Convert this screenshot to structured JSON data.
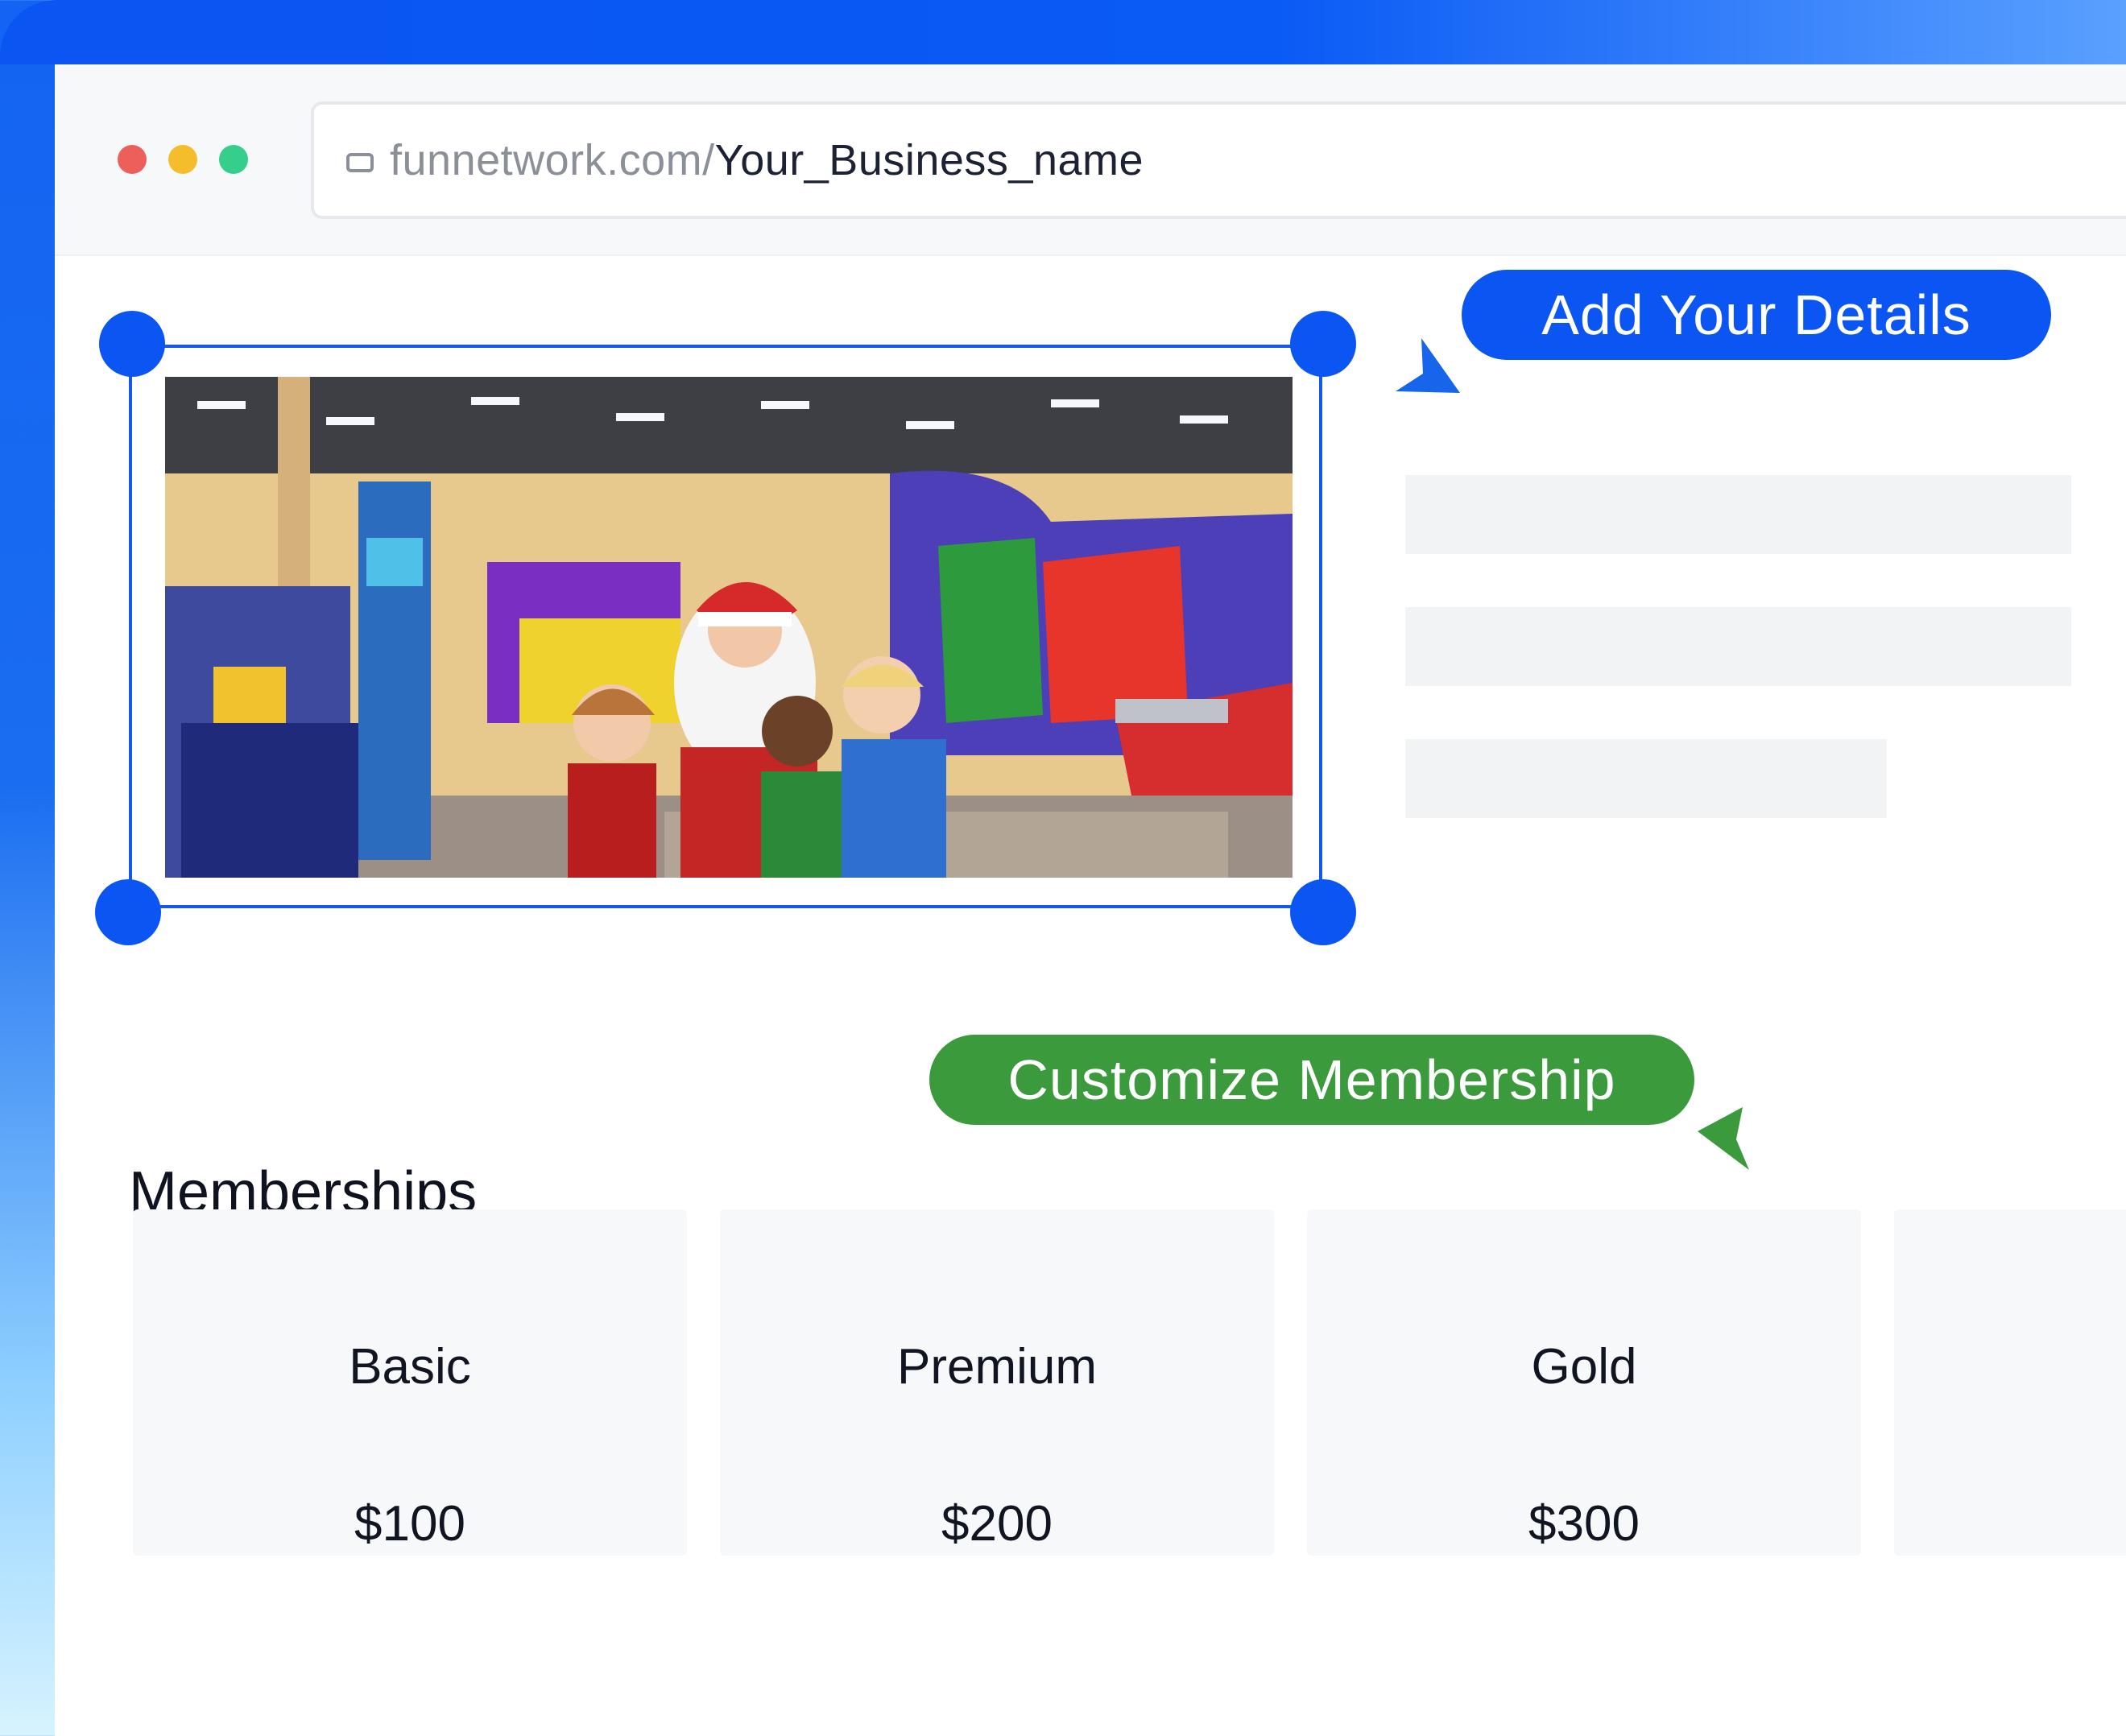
{
  "browser": {
    "url_domain": "funnetwork.com/",
    "url_path": "Your_Business_name"
  },
  "callouts": {
    "add_details": "Add Your Details",
    "customize_membership": "Customize Membership"
  },
  "memberships": {
    "title": "Memberships",
    "plans": [
      {
        "name": "Basic",
        "price": "$100"
      },
      {
        "name": "Premium",
        "price": "$200"
      },
      {
        "name": "Gold",
        "price": "$300"
      }
    ]
  },
  "colors": {
    "accent_blue": "#0b55f2",
    "accent_green": "#3a9a3c",
    "dot_red": "#ec5f5a",
    "dot_yellow": "#f3bd2c",
    "dot_green": "#35cf8b"
  }
}
